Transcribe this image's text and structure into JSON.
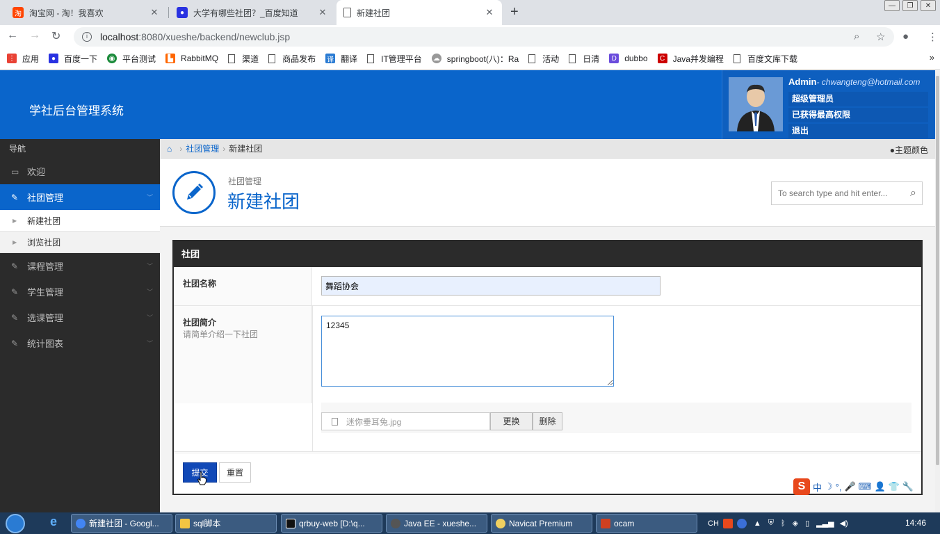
{
  "browser": {
    "tabs": [
      {
        "title": "淘宝网 - 淘！我喜欢",
        "icon": "taobao-icon",
        "color": "#f40"
      },
      {
        "title": "大学有哪些社团？_百度知道",
        "icon": "baidu-paw-icon",
        "color": "#2932e1"
      },
      {
        "title": "新建社团",
        "icon": "page-icon",
        "color": "#ffffff"
      }
    ],
    "url_host": "localhost",
    "url_path": ":8080/xueshe/backend/newclub.jsp",
    "bookmarks": [
      {
        "label": "应用",
        "icon": "apps-icon"
      },
      {
        "label": "百度一下",
        "icon": "baidu-paw-icon"
      },
      {
        "label": "平台测试",
        "icon": "globe-icon"
      },
      {
        "label": "RabbitMQ",
        "icon": "rabbitmq-icon"
      },
      {
        "label": "渠道",
        "icon": "page-icon"
      },
      {
        "label": "商品发布",
        "icon": "page-icon"
      },
      {
        "label": "翻译",
        "icon": "translate-icon"
      },
      {
        "label": "IT管理平台",
        "icon": "page-icon"
      },
      {
        "label": "springboot(八)：Ra",
        "icon": "cloud-icon"
      },
      {
        "label": "活动",
        "icon": "page-icon"
      },
      {
        "label": "日清",
        "icon": "page-icon"
      },
      {
        "label": "dubbo",
        "icon": "dubbo-icon"
      },
      {
        "label": "Java并发编程",
        "icon": "csdn-icon"
      },
      {
        "label": "百度文库下载",
        "icon": "page-icon"
      }
    ]
  },
  "app": {
    "title": "学社后台管理系统",
    "user": {
      "name": "Admin",
      "email": "- chwangteng@hotmail.com",
      "menu": [
        "超级管理员",
        "已获得最高权限",
        "退出"
      ]
    }
  },
  "sidebar": {
    "header": "导航",
    "items": [
      {
        "label": "欢迎",
        "icon": "monitor-icon",
        "active": false
      },
      {
        "label": "社团管理",
        "icon": "pencil-icon",
        "active": true,
        "children": [
          "新建社团",
          "浏览社团"
        ]
      },
      {
        "label": "课程管理",
        "icon": "pencil-icon",
        "active": false
      },
      {
        "label": "学生管理",
        "icon": "pencil-icon",
        "active": false
      },
      {
        "label": "选课管理",
        "icon": "pencil-icon",
        "active": false
      },
      {
        "label": "统计图表",
        "icon": "pencil-icon",
        "active": false
      }
    ]
  },
  "breadcrumb": {
    "parent": "社团管理",
    "current": "新建社团",
    "theme": "主题颜色"
  },
  "page": {
    "subtitle": "社团管理",
    "title": "新建社团",
    "search_placeholder": "To search type and hit enter..."
  },
  "form": {
    "panel_title": "社团",
    "name_label": "社团名称",
    "name_value": "舞蹈协会",
    "desc_label": "社团简介",
    "desc_hint": "请简单介绍一下社团",
    "desc_value": "12345",
    "file_name": "迷你垂耳兔.jpg",
    "change_label": "更换",
    "delete_label": "删除",
    "submit_label": "提交",
    "reset_label": "重置"
  },
  "ime": {
    "items": [
      "中",
      "☽",
      "°,",
      "🎤",
      "⌨",
      "👤",
      "👕",
      "🔧"
    ]
  },
  "taskbar": {
    "tasks": [
      {
        "label": "新建社团 - Googl...",
        "color": "#4285f4"
      },
      {
        "label": "sql脚本",
        "color": "#f4c542"
      },
      {
        "label": "qrbuy-web [D:\\q...",
        "color": "#111111"
      },
      {
        "label": "Java EE - xueshe...",
        "color": "#555555"
      },
      {
        "label": "Navicat Premium",
        "color": "#f0d060"
      },
      {
        "label": "ocam",
        "color": "#d04020"
      }
    ],
    "tray_lang": "CH",
    "time": "14:46"
  },
  "colors": {
    "primary": "#0a65cb",
    "sidebar": "#2b2b2b",
    "submit": "#1149b7"
  }
}
